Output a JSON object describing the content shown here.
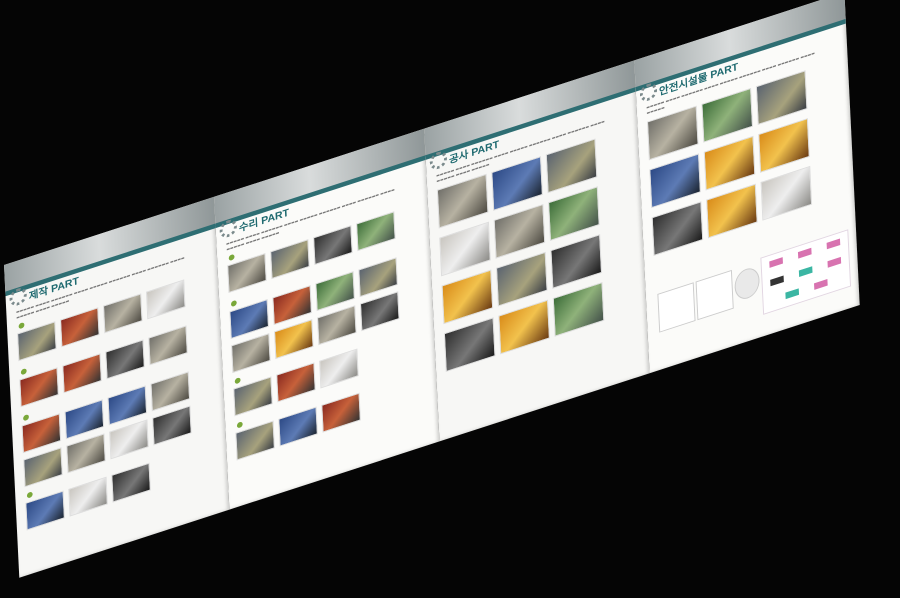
{
  "panels": [
    {
      "title": "제작 PART"
    },
    {
      "title": "수리 PART"
    },
    {
      "title": "공사 PART"
    },
    {
      "title": "안전시설물 PART"
    }
  ]
}
